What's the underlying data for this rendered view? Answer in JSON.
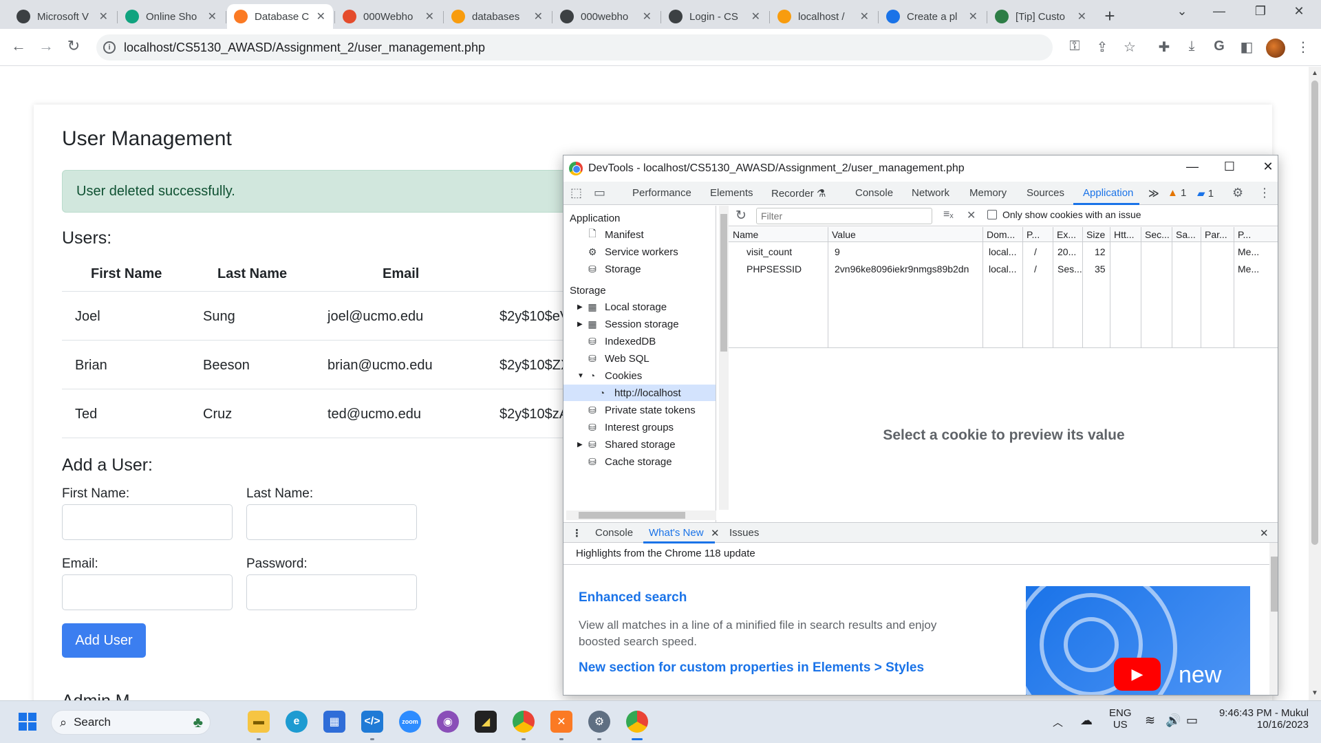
{
  "browser": {
    "tabs": [
      {
        "title": "Microsoft V",
        "icon": "github-icon",
        "color": "#3c4043"
      },
      {
        "title": "Online Sho",
        "icon": "chatgpt-icon",
        "color": "#10a37f"
      },
      {
        "title": "Database C",
        "icon": "xampp-icon",
        "color": "#fb7a24",
        "active": true
      },
      {
        "title": "000Webho",
        "icon": "webhost-icon",
        "color": "#e44c2c"
      },
      {
        "title": "databases",
        "icon": "phpmyadmin-icon",
        "color": "#f89c0e"
      },
      {
        "title": "000webho",
        "icon": "github-icon",
        "color": "#3c4043"
      },
      {
        "title": "Login - CS",
        "icon": "github-icon",
        "color": "#3c4043"
      },
      {
        "title": "localhost /",
        "icon": "phpmyadmin-icon",
        "color": "#f89c0e"
      },
      {
        "title": "Create a pl",
        "icon": "edge-icon",
        "color": "#1a73e8"
      },
      {
        "title": "[Tip] Custo",
        "icon": "bookmark-icon",
        "color": "#2d7d46"
      }
    ],
    "url": "localhost/CS5130_AWASD/Assignment_2/user_management.php"
  },
  "page": {
    "title": "User Management",
    "alert": "User deleted successfully.",
    "users_heading": "Users:",
    "table": {
      "headers": [
        "First Name",
        "Last Name",
        "Email"
      ],
      "rows": [
        [
          "Joel",
          "Sung",
          "joel@ucmo.edu",
          "$2y$10$eV"
        ],
        [
          "Brian",
          "Beeson",
          "brian@ucmo.edu",
          "$2y$10$ZX"
        ],
        [
          "Ted",
          "Cruz",
          "ted@ucmo.edu",
          "$2y$10$zA"
        ]
      ]
    },
    "add_heading": "Add a User:",
    "form": {
      "first_name_label": "First Name:",
      "last_name_label": "Last Name:",
      "email_label": "Email:",
      "password_label": "Password:",
      "submit_label": "Add User"
    },
    "partial_heading": "Admin M"
  },
  "devtools": {
    "title": "DevTools - localhost/CS5130_AWASD/Assignment_2/user_management.php",
    "tabs": [
      "Performance",
      "Elements",
      "Recorder",
      "Console",
      "Network",
      "Memory",
      "Sources",
      "Application"
    ],
    "active_tab": "Application",
    "more_tabs": "≫",
    "warnings_count": "1",
    "messages_count": "1",
    "sidebar": {
      "application_section": "Application",
      "application_items": [
        "Manifest",
        "Service workers",
        "Storage"
      ],
      "storage_section": "Storage",
      "storage_items": [
        "Local storage",
        "Session storage",
        "IndexedDB",
        "Web SQL",
        "Cookies",
        "http://localhost",
        "Private state tokens",
        "Interest groups",
        "Shared storage",
        "Cache storage"
      ]
    },
    "cookies": {
      "filter_placeholder": "Filter",
      "only_issues_label": "Only show cookies with an issue",
      "columns": [
        "Name",
        "Value",
        "Dom...",
        "P...",
        "Ex...",
        "Size",
        "Htt...",
        "Sec...",
        "Sa...",
        "Par...",
        "P..."
      ],
      "rows": [
        [
          "visit_count",
          "9",
          "local...",
          "/",
          "20...",
          "12",
          "",
          "",
          "",
          "",
          "Me..."
        ],
        [
          "PHPSESSID",
          "2vn96ke8096iekr9nmgs89b2dn",
          "local...",
          "/",
          "Ses...",
          "35",
          "",
          "",
          "",
          "",
          "Me..."
        ]
      ],
      "preview_text": "Select a cookie to preview its value"
    },
    "drawer": {
      "tabs": [
        "Console",
        "What's New",
        "Issues"
      ],
      "active_tab": "What's New",
      "subtitle": "Highlights from the Chrome 118 update",
      "heading1": "Enhanced search",
      "paragraph1": "View all matches in a line of a minified file in search results and enjoy boosted search speed.",
      "heading2": "New section for custom properties in Elements > Styles",
      "video_label": "new"
    }
  },
  "taskbar": {
    "search_label": "Search",
    "language": "ENG",
    "region": "US",
    "time": "9:46:43 PM - Mukul",
    "date": "10/16/2023"
  }
}
